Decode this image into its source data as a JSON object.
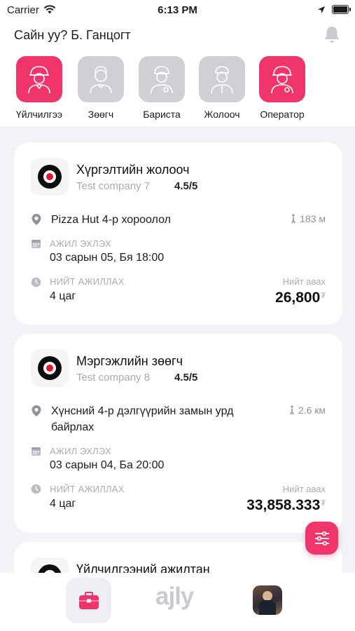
{
  "status_bar": {
    "carrier": "Carrier",
    "time": "6:13 PM"
  },
  "header": {
    "greeting": "Сайн уу? Б. Ганцогт"
  },
  "categories": [
    {
      "label": "Үйлчилгээ",
      "active": true
    },
    {
      "label": "Зөөгч",
      "active": false
    },
    {
      "label": "Бариста",
      "active": false
    },
    {
      "label": "Жолооч",
      "active": false
    },
    {
      "label": "Оператор",
      "active": true
    }
  ],
  "jobs": [
    {
      "title": "Хүргэлтийн жолооч",
      "company": "Test company 7",
      "rating": "4.5/5",
      "location": "Pizza Hut 4-р хороолол",
      "distance": "183 м",
      "start_label": "АЖИЛ ЭХЛЭХ",
      "start_value": "03 сарын 05, Бя 18:00",
      "duration_label": "НИЙТ АЖИЛЛАХ",
      "duration_value": "4 цаг",
      "total_label": "Нийт авах",
      "total_value": "26,800",
      "currency": "₮"
    },
    {
      "title": "Мэргэжлийн зөөгч",
      "company": "Test company 8",
      "rating": "4.5/5",
      "location": "Хүнсний 4-р дэлгүүрийн замын урд байрлах",
      "distance": "2.6 км",
      "start_label": "АЖИЛ ЭХЛЭХ",
      "start_value": "03 сарын 04, Ба 20:00",
      "duration_label": "НИЙТ АЖИЛЛАХ",
      "duration_value": "4 цаг",
      "total_label": "Нийт авах",
      "total_value": "33,858.333",
      "currency": "₮"
    },
    {
      "title": "Үйлчилгээний ажилтан"
    }
  ],
  "nav": {
    "logo_text": "ajly"
  },
  "colors": {
    "accent": "#f0356a",
    "inactive": "#cfd0d4",
    "muted_text": "#a7abb3"
  }
}
